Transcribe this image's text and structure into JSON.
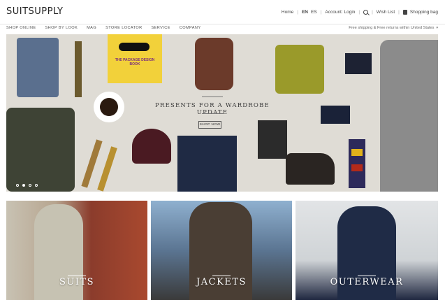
{
  "brand": {
    "logo": "SUITSUPPLY"
  },
  "top_links": {
    "home": "Home",
    "lang_en": "EN",
    "lang_es": "ES",
    "account": "Account: Login",
    "search_icon": "search-icon",
    "wishlist": "Wish List",
    "bag_icon": "shopping-bag-icon",
    "bag": "Shopping bag"
  },
  "nav": {
    "items": [
      {
        "label": "SHOP ONLINE"
      },
      {
        "label": "SHOP BY LOOK"
      },
      {
        "label": "MAG"
      },
      {
        "label": "STORE LOCATOR"
      },
      {
        "label": "SERVICE"
      },
      {
        "label": "COMPANY"
      }
    ],
    "shipping": "Free shipping & Free returns within United States"
  },
  "hero": {
    "title": "PRESENTS FOR A WARDROBE UPDATE",
    "cta": "SHOP NOW",
    "slides": 4,
    "active_slide": 2,
    "book_title": "THE PACKAGE DESIGN BOOK",
    "colors": {
      "background": "#dfdcd5"
    }
  },
  "tiles": [
    {
      "label": "SUITS"
    },
    {
      "label": "JACKETS"
    },
    {
      "label": "OUTERWEAR"
    }
  ]
}
